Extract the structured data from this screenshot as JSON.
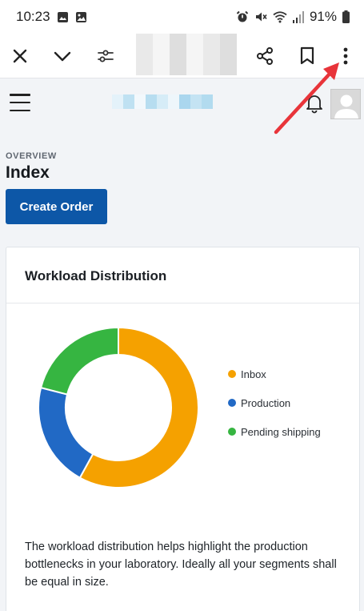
{
  "status_bar": {
    "time": "10:23",
    "battery": "91%"
  },
  "browser": {
    "icons": [
      "close-icon",
      "chevron-down-icon",
      "page-settings-icon",
      "share-icon",
      "bookmark-icon",
      "more-vert-icon"
    ]
  },
  "app": {
    "overview_label": "OVERVIEW",
    "page_title": "Index",
    "create_order_label": "Create Order"
  },
  "card": {
    "title": "Workload Distribution",
    "description": "The workload distribution helps highlight the production bottlenecks in your laboratory. Ideally all your segments shall be equal in size."
  },
  "colors": {
    "inbox": "#f5a100",
    "production": "#2169c5",
    "pending_shipping": "#36b541",
    "primary_button": "#0d57a7",
    "annotation_arrow": "#e8343a"
  },
  "chart_data": {
    "type": "pie",
    "variant": "donut",
    "categories": [
      "Inbox",
      "Production",
      "Pending shipping"
    ],
    "values": [
      58,
      21,
      21
    ],
    "legend_position": "right"
  }
}
